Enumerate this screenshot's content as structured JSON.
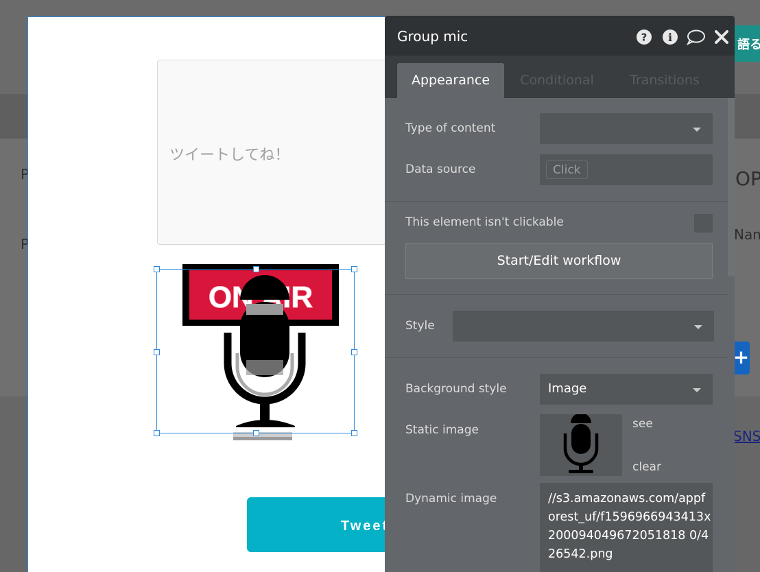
{
  "background_page": {
    "right_button_text": "語る",
    "fragment_p1": "P",
    "fragment_p2": "P",
    "fragment_op": "OP",
    "fragment_name": "Nam",
    "blue_button_symbol": "+",
    "link_fragment": "SNS"
  },
  "canvas": {
    "tweet_placeholder": "ツイートしてね！",
    "tweet_button_label": "Tweet",
    "mic_image_text": "ON AIR"
  },
  "panel": {
    "title": "Group mic",
    "header_icons": [
      "help-icon",
      "info-icon",
      "comment-icon",
      "close-icon"
    ],
    "tabs": [
      {
        "label": "Appearance",
        "active": true
      },
      {
        "label": "Conditional",
        "active": false
      },
      {
        "label": "Transitions",
        "active": false
      }
    ],
    "type_of_content": {
      "label": "Type of content",
      "value": ""
    },
    "data_source": {
      "label": "Data source",
      "value": "Click"
    },
    "clickable": {
      "label": "This element isn't clickable",
      "checked": false
    },
    "workflow_button": "Start/Edit workflow",
    "style": {
      "label": "Style",
      "value": ""
    },
    "background_style": {
      "label": "Background style",
      "value": "Image"
    },
    "static_image": {
      "label": "Static image",
      "see": "see",
      "clear": "clear"
    },
    "dynamic_image": {
      "label": "Dynamic image",
      "value": "//s3.amazonaws.com/appforest_uf/f1596966943413x200094049672051818 0/426542.png"
    }
  },
  "colors": {
    "accent": "#04b1c6",
    "selection": "#2d8ae0",
    "panel_bg": "#63666a",
    "panel_header": "#2e3234"
  }
}
